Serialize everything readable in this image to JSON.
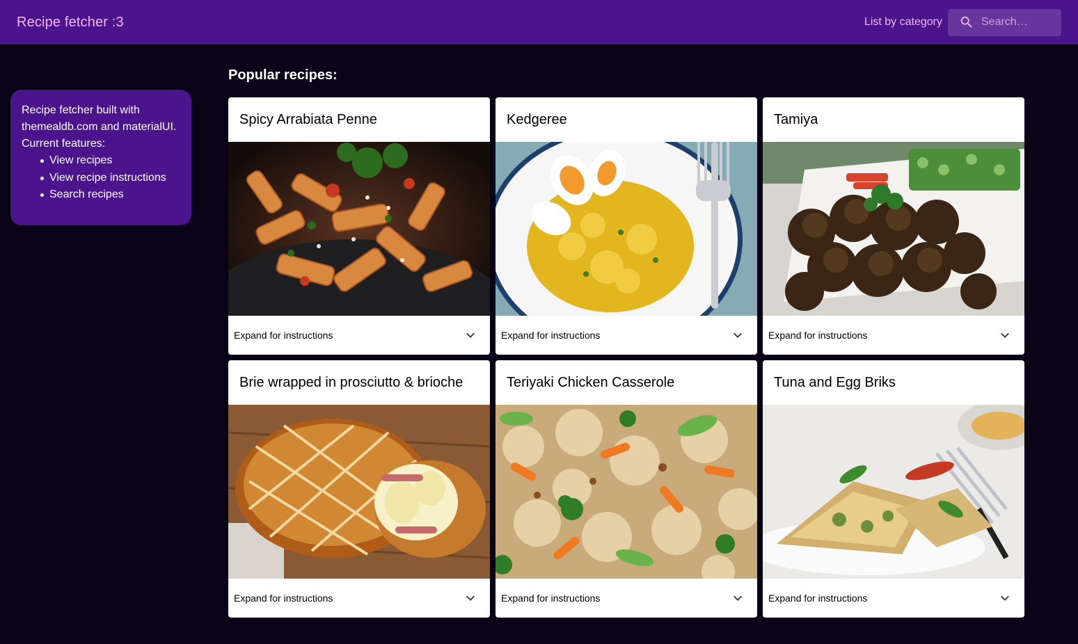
{
  "appbar": {
    "title": "Recipe fetcher :3",
    "nav_link": "List by category",
    "search_placeholder": "Search…"
  },
  "sidebar": {
    "intro_line1": "Recipe fetcher built with",
    "intro_line2": "themealdb.com and materialUI.",
    "intro_line3": "Current features:",
    "features": [
      "View recipes",
      "View recipe instructions",
      "Search recipes"
    ]
  },
  "main": {
    "section_title": "Popular recipes:",
    "expand_label": "Expand for instructions",
    "recipes": [
      {
        "title": "Spicy Arrabiata Penne",
        "image": "pasta-image"
      },
      {
        "title": "Kedgeree",
        "image": "rice-egg-image"
      },
      {
        "title": "Tamiya",
        "image": "falafel-image"
      },
      {
        "title": "Brie wrapped in prosciutto & brioche",
        "image": "brioche-image"
      },
      {
        "title": "Teriyaki Chicken Casserole",
        "image": "fried-rice-image"
      },
      {
        "title": "Tuna and Egg Briks",
        "image": "brik-image"
      }
    ]
  },
  "colors": {
    "appbar": "#4a148c",
    "background": "#0b0318",
    "accent_text": "#f3b6f0"
  },
  "icons": [
    "search-icon",
    "chevron-down-icon"
  ]
}
